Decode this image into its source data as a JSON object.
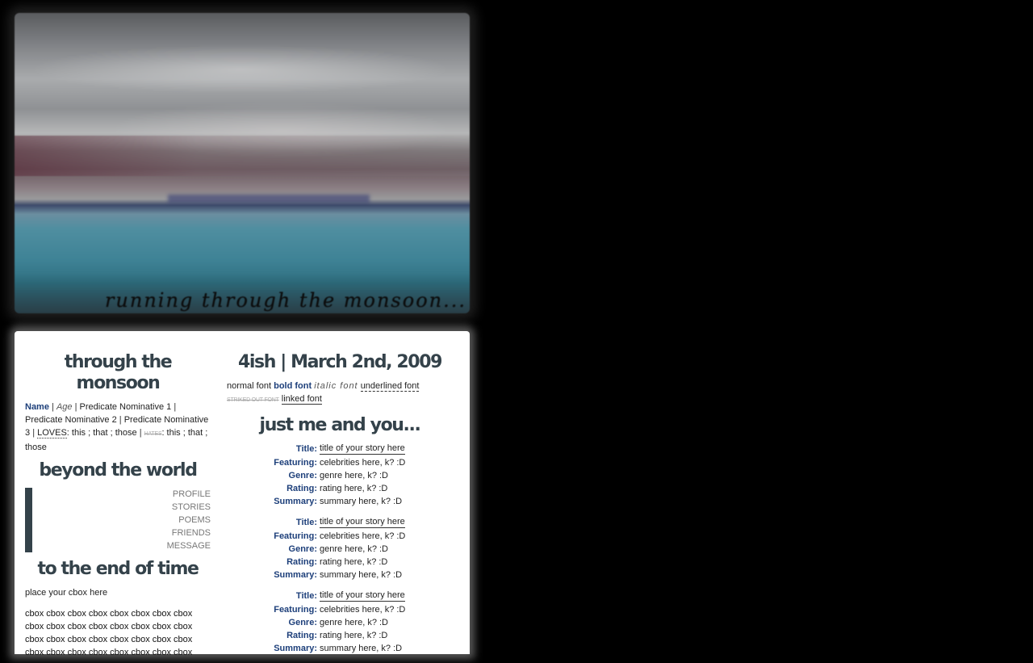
{
  "banner": {
    "caption": "running through the monsoon..."
  },
  "left": {
    "title": "through the monsoon",
    "profile": {
      "name": "Name",
      "age": "Age",
      "pn1": "Predicate Nominative 1",
      "pn2": "Predicate Nominative 2",
      "pn3": "Predicate Nominative 3",
      "loves_label": "LOVES",
      "loves_value": ": this ; that ; those",
      "hates_label": "HATES",
      "hates_value": ": this ; that ; those",
      "sep": "|"
    },
    "nav_title": "beyond the world",
    "nav": [
      "PROFILE",
      "STORIES",
      "POEMS",
      "FRIENDS",
      "MESSAGE"
    ],
    "cbox_title": "to the end of time",
    "cbox_place": "place your cbox here",
    "cbox_lines": [
      "cbox cbox cbox cbox cbox cbox cbox cbox",
      "cbox cbox cbox cbox cbox cbox cbox cbox",
      "cbox cbox cbox cbox cbox cbox cbox cbox",
      "cbox cbox cbox cbox cbox cbox cbox cbox"
    ]
  },
  "right": {
    "title": "4ish | March 2nd, 2009",
    "fonts": {
      "normal": "normal font",
      "bold": "bold font",
      "italic": "italic font",
      "underlined": "underlined font",
      "striked": "STRIKED OUT FONT",
      "linked": "linked font"
    },
    "stories_title": "just me and you...",
    "labels": {
      "title": "Title:",
      "featuring": "Featuring:",
      "genre": "Genre:",
      "rating": "Rating:",
      "summary": "Summary:"
    },
    "stories": [
      {
        "title": "title of your story here",
        "featuring": "celebrities here, k? :D",
        "genre": "genre here, k? :D",
        "rating": "rating here, k? :D",
        "summary": "summary here, k? :D"
      },
      {
        "title": "title of your story here",
        "featuring": "celebrities here, k? :D",
        "genre": "genre here, k? :D",
        "rating": "rating here, k? :D",
        "summary": "summary here, k? :D"
      },
      {
        "title": "title of your story here",
        "featuring": "celebrities here, k? :D",
        "genre": "genre here, k? :D",
        "rating": "rating here, k? :D",
        "summary": "summary here, k? :D"
      }
    ]
  }
}
